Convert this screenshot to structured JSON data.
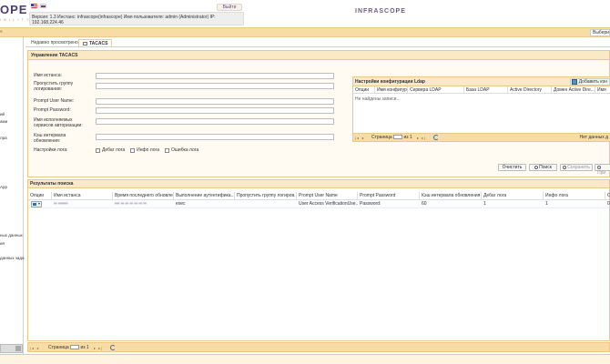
{
  "header": {
    "brand_left": "OPE",
    "brand_left_sub": "I B I L I T Y",
    "version_line1": "Версия: 1.3 Инстанс: infrascope(infrascope) Имя пользователя: admin (Administrator) IP:",
    "version_line2": "192.168.224.46",
    "logout_label": "Выйти",
    "brand_center": "INFRASCOPE",
    "right_field_value": "Выбери"
  },
  "sidebar": {
    "items": [
      "ий",
      "ами",
      "лра",
      "App",
      "ных данных",
      "ия",
      "данных зада"
    ]
  },
  "tabs": [
    {
      "label": "Недавно просмотрено"
    },
    {
      "label": "TACACS"
    }
  ],
  "management": {
    "title": "Управление TACACS",
    "fields": [
      {
        "label": "Имя истанса:"
      },
      {
        "label": "Пропустить группу логирования:"
      },
      {
        "label": "Prompt User Name:"
      },
      {
        "label": "Prompt Password:"
      },
      {
        "label": "Имя исполняемых сервисов авторизации:"
      },
      {
        "label": "Кэш интервала обновления:"
      }
    ],
    "log_settings_label": "Настройки лога:",
    "checkboxes": [
      "Дебаг лога",
      "Инфо лога",
      "Ошибка лога"
    ]
  },
  "ldap": {
    "title": "Настройки конфигурации Ldap",
    "add_label": "Добавить кон",
    "columns": [
      "Опции",
      "Имя конфигурации",
      "Сервера LDAP",
      "База LDAP",
      "Active Directory",
      "Домен Active Dire...",
      "Имя"
    ],
    "empty_text": "Не найдены записи...",
    "pager_page_label": "Страница",
    "pager_of_label": "из 1",
    "pager_nodata": "Нет данных д"
  },
  "actions": {
    "clear_label": "Очистить",
    "search_label": "Поиск",
    "save_label": "Сохранить",
    "extra_label": "При"
  },
  "results": {
    "title": "Результаты поиска",
    "columns": [
      "Опции",
      "Имя истанса",
      "Время последнего обновле...",
      "Выполнение аутентифика...",
      "Пропустить группу логиров...",
      "Prompt User Name",
      "Prompt Password",
      "Кэш интервала обновления",
      "Дебаг лога",
      "Инфо лога",
      "О"
    ],
    "row": {
      "instance": "▪▪ ▪▪▪▪▪▪",
      "last_update": "▪▪▪ ▪▪ ▪▪ ▪▪ ▪▪ ▪▪ ▪▪",
      "auth_exec": "exec",
      "skip_group": "",
      "prompt_user": "User Access VerificationUse...",
      "prompt_password": "Password:",
      "cache_interval": "60",
      "debug_log": "1",
      "info_log": "1",
      "error_log": "0"
    },
    "pager_page_label": "Страница",
    "pager_of_label": "из 1"
  },
  "colors": {
    "accent_orange": "#f8dca6",
    "border_orange": "#eac88a",
    "brand_purple": "#4b3a6e"
  }
}
